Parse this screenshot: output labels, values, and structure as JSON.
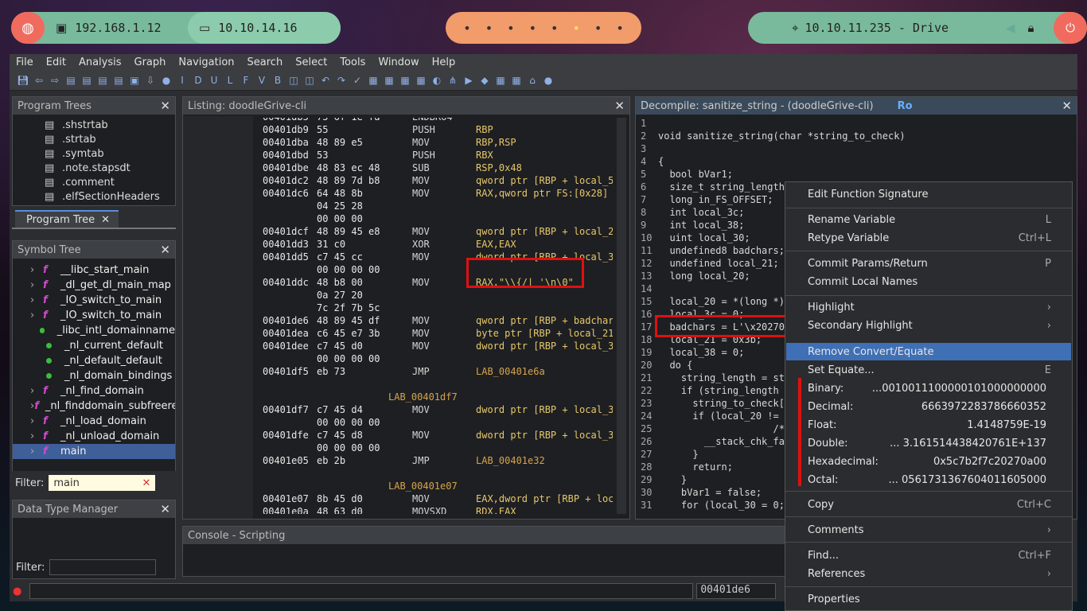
{
  "panel": {
    "ip1": "192.168.1.12",
    "ip2": "10.10.14.16",
    "ws_dots": [
      "•",
      "•",
      "•",
      "•",
      "•",
      "•",
      "•",
      "•"
    ],
    "ws_current": 5,
    "drive": "10.10.11.235 - Drive"
  },
  "menu": [
    "File",
    "Edit",
    "Analysis",
    "Graph",
    "Navigation",
    "Search",
    "Select",
    "Tools",
    "Window",
    "Help"
  ],
  "program_trees": {
    "title": "Program Trees",
    "items": [
      ".shstrtab",
      ".strtab",
      ".symtab",
      ".note.stapsdt",
      ".comment",
      ".elfSectionHeaders"
    ],
    "tab": "Program Tree"
  },
  "symbol_tree": {
    "title": "Symbol Tree",
    "items": [
      {
        "label": "__libc_start_main",
        "kind": "f"
      },
      {
        "label": "_dl_get_dl_main_map",
        "kind": "f"
      },
      {
        "label": "_IO_switch_to_main",
        "kind": "f"
      },
      {
        "label": "_IO_switch_to_main",
        "kind": "f"
      },
      {
        "label": "_libc_intl_domainname",
        "kind": "dot"
      },
      {
        "label": "_nl_current_default",
        "kind": "dot"
      },
      {
        "label": "_nl_default_default",
        "kind": "dot"
      },
      {
        "label": "_nl_domain_bindings",
        "kind": "dot"
      },
      {
        "label": "_nl_find_domain",
        "kind": "f"
      },
      {
        "label": "_nl_finddomain_subfreeres",
        "kind": "f"
      },
      {
        "label": "_nl_load_domain",
        "kind": "f"
      },
      {
        "label": "_nl_unload_domain",
        "kind": "f"
      },
      {
        "label": "main",
        "kind": "f"
      }
    ],
    "filter_label": "Filter:",
    "filter_value": "main"
  },
  "data_type_manager": {
    "title": "Data Type Manager",
    "filter_label": "Filter:"
  },
  "listing": {
    "title": "Listing:  doodleGrive-cli",
    "lines": [
      [
        "00401db5",
        "75 6f 1e fa",
        "",
        "ENDBR64",
        ""
      ],
      [
        "00401db9",
        "55",
        "",
        "PUSH",
        "RBP"
      ],
      [
        "00401dba",
        "48 89 e5",
        "",
        "MOV",
        "RBP,RSP"
      ],
      [
        "00401dbd",
        "53",
        "",
        "PUSH",
        "RBX"
      ],
      [
        "00401dbe",
        "48 83 ec 48",
        "",
        "SUB",
        "RSP,0x48"
      ],
      [
        "00401dc2",
        "48 89 7d b8",
        "",
        "MOV",
        "qword ptr [RBP + local_50]"
      ],
      [
        "00401dc6",
        "64 48 8b",
        "",
        "MOV",
        "RAX,qword ptr FS:[0x28]"
      ],
      [
        "",
        "04 25 28",
        "",
        "",
        ""
      ],
      [
        "",
        "00 00 00",
        "",
        "",
        ""
      ],
      [
        "00401dcf",
        "48 89 45 e8",
        "",
        "MOV",
        "qword ptr [RBP + local_20]"
      ],
      [
        "00401dd3",
        "31 c0",
        "",
        "XOR",
        "EAX,EAX"
      ],
      [
        "00401dd5",
        "c7 45 cc",
        "",
        "MOV",
        "dword ptr [RBP + local_3c]"
      ],
      [
        "",
        "00 00 00 00",
        "",
        "",
        ""
      ],
      [
        "00401ddc",
        "48 b8 00",
        "",
        "MOV",
        "RAX,\"\\\\{/| '\\n\\0\""
      ],
      [
        "",
        "0a 27 20",
        "",
        "",
        ""
      ],
      [
        "",
        "7c 2f 7b 5c",
        "",
        "",
        ""
      ],
      [
        "00401de6",
        "48 89 45 df",
        "",
        "MOV",
        "qword ptr [RBP + badchars]"
      ],
      [
        "00401dea",
        "c6 45 e7 3b",
        "",
        "MOV",
        "byte ptr [RBP + local_21]"
      ],
      [
        "00401dee",
        "c7 45 d0",
        "",
        "MOV",
        "dword ptr [RBP + local_38]"
      ],
      [
        "",
        "00 00 00 00",
        "",
        "",
        ""
      ],
      [
        "00401df5",
        "eb 73",
        "",
        "JMP",
        "LAB_00401e6a"
      ],
      [
        "",
        "",
        "",
        "",
        ""
      ],
      [
        "",
        "",
        "LAB_00401df7",
        "",
        ""
      ],
      [
        "00401df7",
        "c7 45 d4",
        "",
        "MOV",
        "dword ptr [RBP + local_34]"
      ],
      [
        "",
        "00 00 00 00",
        "",
        "",
        ""
      ],
      [
        "00401dfe",
        "c7 45 d8",
        "",
        "MOV",
        "dword ptr [RBP + local_30]"
      ],
      [
        "",
        "00 00 00 00",
        "",
        "",
        ""
      ],
      [
        "00401e05",
        "eb 2b",
        "",
        "JMP",
        "LAB_00401e32"
      ],
      [
        "",
        "",
        "",
        "",
        ""
      ],
      [
        "",
        "",
        "LAB_00401e07",
        "",
        ""
      ],
      [
        "00401e07",
        "8b 45 d0",
        "",
        "MOV",
        "EAX,dword ptr [RBP + local_38]"
      ],
      [
        "00401e0a",
        "48 63 d0",
        "",
        "MOVSXD",
        "RDX,EAX"
      ]
    ]
  },
  "decompile": {
    "title": "Decompile: sanitize_string -  (doodleGrive-cli)",
    "ro": "Ro",
    "lines": [
      "",
      "void sanitize_string(char *string_to_check)",
      "",
      "{",
      "  bool bVar1;",
      "  size_t string_length;",
      "  long in_FS_OFFSET;",
      "  int local_3c;",
      "  int local_38;",
      "  uint local_30;",
      "  undefined8 badchars;",
      "  undefined local_21;",
      "  long local_20;",
      "",
      "  local_20 = *(long *)(in_FS_OFFSET + 0x28);",
      "  local_3c = 0;",
      "  badchars = L'\\x20270a0';",
      "  local_21 = 0x3b;",
      "  local_38 = 0;",
      "  do {",
      "    string_length = strlen(string_to_check);",
      "    if (string_length <= (ulong)(long)local_38) {",
      "      string_to_check[local_3c] = '\\0';",
      "      if (local_20 != *(long *)(in_FS_OFFSET + 0x28)) {",
      "                    /* WARNING: Subroutine does not return */",
      "        __stack_chk_fail();",
      "      }",
      "      return;",
      "    }",
      "    bVar1 = false;",
      "    for (local_30 = 0; local_30 < 9; local_30 = local_30 + 1) {"
    ]
  },
  "console": {
    "title": "Console - Scripting"
  },
  "status": {
    "address": "00401de6"
  },
  "context_menu": {
    "edit_signature": "Edit Function Signature",
    "rename_variable": "Rename Variable",
    "rename_shortcut": "L",
    "retype_variable": "Retype Variable",
    "retype_shortcut": "Ctrl+L",
    "commit_params": "Commit Params/Return",
    "commit_params_shortcut": "P",
    "commit_locals": "Commit Local Names",
    "highlight": "Highlight",
    "secondary_highlight": "Secondary Highlight",
    "remove_convert": "Remove Convert/Equate",
    "set_equate": "Set Equate...",
    "set_equate_shortcut": "E",
    "conversions": [
      {
        "label": "Binary:",
        "value": "...0010011100000101000000000"
      },
      {
        "label": "Decimal:",
        "value": "6663972283786660352"
      },
      {
        "label": "Float:",
        "value": "1.4148759E-19"
      },
      {
        "label": "Double:",
        "value": "...  3.161514438420761E+137"
      },
      {
        "label": "Hexadecimal:",
        "value": "0x5c7b2f7c20270a00"
      },
      {
        "label": "Octal:",
        "value": "...  0561731367604011605000"
      }
    ],
    "copy": "Copy",
    "copy_shortcut": "Ctrl+C",
    "comments": "Comments",
    "find": "Find...",
    "find_shortcut": "Ctrl+F",
    "references": "References",
    "properties": "Properties"
  }
}
